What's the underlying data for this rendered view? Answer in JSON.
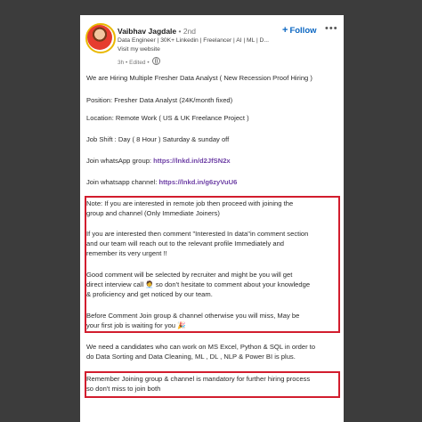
{
  "author": {
    "name": "Vaibhav Jagdale",
    "degree": " • 2nd",
    "headline": "Data Engineer | 30K+ Linkedin | Freelancer | AI | ML | D...",
    "website": "Visit my website",
    "meta": "3h • Edited •"
  },
  "actions": {
    "follow_label": "Follow",
    "more_label": "•••"
  },
  "post": {
    "l1": "We are Hiring Multiple Fresher Data Analyst ( New Recession Proof Hiring )",
    "l2": "Position: Fresher Data Analyst (24K/month fixed)",
    "l3": "Location: Remote Work ( US & UK Freelance Project )",
    "l4": "Job Shift : Day ( 8 Hour ) Saturday & sunday off",
    "l5_text": "Join whatsApp group: ",
    "l5_link": "https://lnkd.in/d2JfSN2x",
    "l6_text": "Join whatsapp channel: ",
    "l6_link": "https://lnkd.in/g6zyVuU6",
    "n1a": "Note: If you are interested in remote job then proceed with joining the",
    "n1b": "group and channel (Only Immediate Joiners)",
    "n2a": "If you are interested then comment \"Interested In data\"in comment section",
    "n2b": "and our team will reach out to the relevant profile Immediately and",
    "n2c": "remember its very urgent !!",
    "n3a": "Good comment will be selected by recruiter and might be you will get",
    "n3b": "direct interview call 🧑‍💼 so don't hesitate to comment about your knowledge",
    "n3c": "& proficiency and get noticed by our team.",
    "n4a": "Before Comment Join group & channel otherwise you will miss, May be",
    "n4b": "your first job is waiting for you 🎉",
    "s1a": "We need a candidates who can work on MS Excel, Python & SQL in order to",
    "s1b": "do Data Sorting and Data Cleaning, ML , DL , NLP & Power BI is plus.",
    "r1a": "Remember Joining group & channel is mandatory for further hiring process",
    "r1b": "so don't miss to join both"
  }
}
